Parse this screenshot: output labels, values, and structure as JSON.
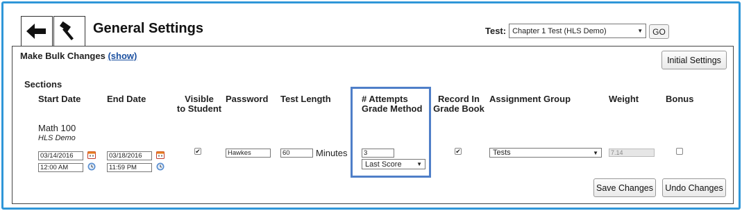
{
  "header": {
    "title": "General Settings",
    "test_label": "Test:",
    "test_selected": "Chapter 1 Test (HLS Demo)",
    "go_label": "GO"
  },
  "panel": {
    "bulk_text": "Make Bulk Changes",
    "bulk_link": "(show)",
    "initial_settings_label": "Initial Settings",
    "sections_label": "Sections",
    "save_label": "Save Changes",
    "undo_label": "Undo Changes"
  },
  "columns": {
    "start_date": "Start Date",
    "end_date": "End Date",
    "visible_line1": "Visible",
    "visible_line2": "to Student",
    "password": "Password",
    "test_length": "Test Length",
    "attempts_line1": "# Attempts",
    "attempts_line2": "Grade Method",
    "record_line1": "Record In",
    "record_line2": "Grade Book",
    "assignment_group": "Assignment Group",
    "weight": "Weight",
    "bonus": "Bonus"
  },
  "row": {
    "course": "Math 100",
    "course_sub": "HLS Demo",
    "start_date": "03/14/2016",
    "start_time": "12:00 AM",
    "end_date": "03/18/2016",
    "end_time": "11:59 PM",
    "visible_checked": true,
    "password": "Hawkes",
    "test_length": "60",
    "minutes_label": "Minutes",
    "attempts": "3",
    "grade_method": "Last Score",
    "record_checked": true,
    "assignment_group": "Tests",
    "weight": "7.14",
    "bonus_checked": false
  },
  "colors": {
    "frame": "#2f96d8",
    "highlight": "#4f7fc8",
    "link": "#1a4fa0"
  }
}
